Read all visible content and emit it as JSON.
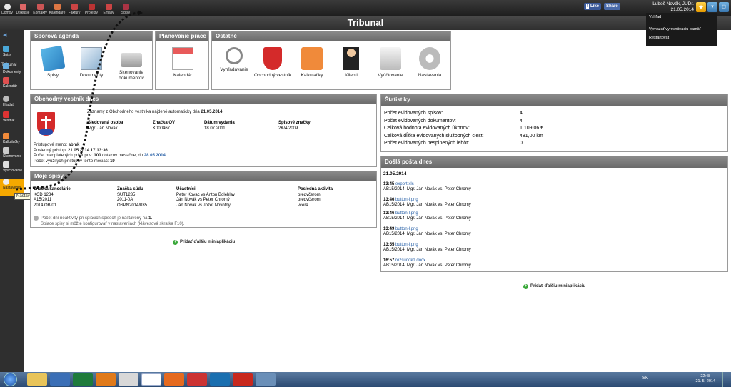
{
  "topnav": [
    {
      "label": "Domov",
      "icon": "home-icon",
      "color": "#e0e0e0"
    },
    {
      "label": "Diskusie",
      "icon": "chat-icon",
      "color": "#d66"
    },
    {
      "label": "Kontakty",
      "icon": "contacts-icon",
      "color": "#c55"
    },
    {
      "label": "Kalendáre",
      "icon": "calendar-icon",
      "color": "#d74"
    },
    {
      "label": "Faktúry",
      "icon": "invoice-icon",
      "color": "#c44"
    },
    {
      "label": "Projekty",
      "icon": "projects-icon",
      "color": "#b33"
    },
    {
      "label": "Emaily",
      "icon": "email-icon",
      "color": "#c44"
    },
    {
      "label": "Spisy",
      "icon": "files-icon",
      "color": "#a34"
    }
  ],
  "facebook": {
    "like": "Like",
    "share": "Share"
  },
  "user": {
    "name": "Luboš Novák, JUDr.",
    "date": "21.05.2014"
  },
  "app_title": "Tribunal",
  "dropdown": {
    "items": [
      "Vzhľad",
      "Vymazať vyrovnávaciu pamäť",
      "Reštartovať"
    ]
  },
  "sidebar": {
    "title": "Tribunal",
    "items": [
      {
        "label": "Spisy",
        "icon": "files-icon"
      },
      {
        "label": "Dokumenty",
        "icon": "documents-icon"
      },
      {
        "label": "Kalendár",
        "icon": "calendar-icon"
      },
      {
        "label": "Hľadať",
        "icon": "search-icon"
      },
      {
        "label": "Vestník",
        "icon": "gazette-icon"
      },
      {
        "label": "Kalkulačky",
        "icon": "calculator-icon"
      },
      {
        "label": "Skenovanie",
        "icon": "scanner-icon"
      },
      {
        "label": "Vyúčtovanie",
        "icon": "billing-icon"
      },
      {
        "label": "Nastavenia",
        "icon": "settings-icon"
      }
    ],
    "tooltip": "Nastavenia"
  },
  "sporova": {
    "title": "Sporová agenda",
    "tiles": [
      "Spisy",
      "Dokumenty",
      "Skenovanie dokumentov"
    ]
  },
  "planovanie": {
    "title": "Plánovanie práce",
    "tiles": [
      "Kalendár"
    ]
  },
  "ostatne": {
    "title": "Ostatné",
    "tiles": [
      "Vyhľadávanie",
      "Obchodný vestník",
      "Kalkulačky",
      "Klienti",
      "Vyúčtovanie",
      "Nastavenia"
    ]
  },
  "vestnik": {
    "title": "Obchodný vestník dnes",
    "intro": "Záznamy z Obchodného vestníka nájdené automaticky dňa",
    "intro_date": "21.05.2014",
    "headers": [
      "Sledovaná osoba",
      "Značka OV",
      "Dátum vydania",
      "Spisové značky"
    ],
    "rows": [
      [
        "Mgr. Ján Novák",
        "K000467",
        "18.07.2011",
        "2K/4/2009"
      ]
    ],
    "access_name_label": "Prístupové meno:",
    "access_name": "abmk",
    "last_access_label": "Posledný prístup:",
    "last_access": "21.05.2014 17:13:36",
    "prepaid_label": "Počet predplatených prístupov:",
    "prepaid_count": "100",
    "prepaid_mid": "dotazov mesačne, do",
    "prepaid_until": "28.05.2014",
    "used_label": "Počet využitých prístupov tento mesiac:",
    "used": "19"
  },
  "moje_spisy": {
    "title": "Moje spisy",
    "headers": [
      "Značka kancelárie",
      "Značka súdu",
      "Účastníci",
      "Posledná aktivita"
    ],
    "rows": [
      [
        "KCD 1234",
        "SUT1235",
        "Peter Kovac vs Anton Bolehlav",
        "predvčerom"
      ],
      [
        "A15/2011",
        "2011-0A",
        "Ján Novák vs Peter Chromý",
        "predvčerom"
      ],
      [
        "2014 OB/01",
        "OSPN2014/035",
        "Ján Novák vs Jozef Novotný",
        "včera"
      ]
    ],
    "note1": "Počet dní neaktivity pri spiacich spisoch je nastavený na",
    "note1_value": "1.",
    "note2": "Spiace spisy si môžte konfigurovať v nastaveniach (klávesová skratka F10)."
  },
  "statistiky": {
    "title": "Štatistiky",
    "rows": [
      [
        "Počet evidovaných spisov:",
        "4"
      ],
      [
        "Počet evidovaných dokumentov:",
        "4"
      ],
      [
        "Celková hodnota evidovaných úkonov:",
        "1 109,06 €"
      ],
      [
        "Celková dĺžka evidovaných služobných ciest:",
        "481,00 km"
      ],
      [
        "Počet evidovaných nesplnených lehôt:",
        "0"
      ]
    ]
  },
  "posta": {
    "title": "Došlá pošta dnes",
    "date": "21.05.2014",
    "items": [
      {
        "time": "13:45",
        "file": "export.xls",
        "case": "AB15/2014, Mgr. Ján Novák vs. Peter Chromý"
      },
      {
        "time": "13:46",
        "file": "button-l.png",
        "case": "AB15/2014, Mgr. Ján Novák vs. Peter Chromý"
      },
      {
        "time": "13:46",
        "file": "button-l.png",
        "case": "AB15/2014, Mgr. Ján Novák vs. Peter Chromý"
      },
      {
        "time": "13:49",
        "file": "button-l.png",
        "case": "AB15/2014, Mgr. Ján Novák vs. Peter Chromý"
      },
      {
        "time": "13:55",
        "file": "button-l.png",
        "case": "AB15/2014, Mgr. Ján Novák vs. Peter Chromý"
      },
      {
        "time": "16:57",
        "file": "rozsudok1.docx",
        "case": "AB15/2014, Mgr. Ján Novák vs. Peter Chromý"
      }
    ]
  },
  "add_mini": "Pridať ďalšiu miniaplikáciu",
  "taskbar": {
    "lang": "SK",
    "time": "22:48",
    "date": "21. 5. 2014",
    "apps": [
      {
        "icon": "explorer-icon",
        "color": "#e8c45a"
      },
      {
        "icon": "media-player-icon",
        "color": "#3b6fb6"
      },
      {
        "icon": "excel-icon",
        "color": "#1e7b3c"
      },
      {
        "icon": "outlook-icon",
        "color": "#e07a1a"
      },
      {
        "icon": "chrome-icon",
        "color": "#d8d8d8"
      },
      {
        "icon": "firefox-icon",
        "color": "#e56a1f"
      },
      {
        "icon": "apps-icon",
        "color": "#c33"
      },
      {
        "icon": "browser-icon",
        "color": "#1a6fb0"
      },
      {
        "icon": "filezilla-icon",
        "color": "#c8281e"
      },
      {
        "icon": "tool-icon",
        "color": "#6a8fb8"
      }
    ]
  },
  "colors": {
    "accent": "#f5a800",
    "link": "#2a62a8",
    "panel_header": "#7a7a7a"
  }
}
